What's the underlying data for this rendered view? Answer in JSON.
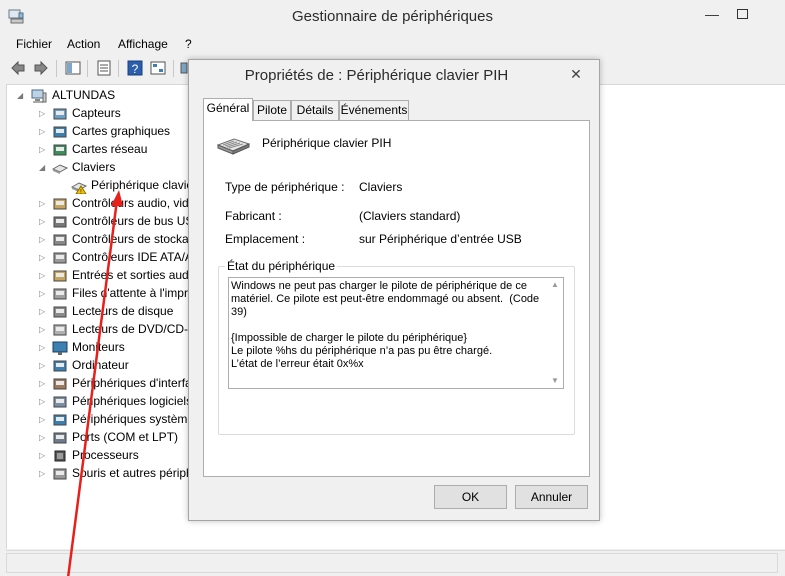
{
  "main_window": {
    "title": "Gestionnaire de périphériques",
    "minimize_glyph": "—"
  },
  "menu": {
    "items": [
      "Fichier",
      "Action",
      "Affichage",
      "?"
    ]
  },
  "tree": {
    "root": "ALTUNDAS",
    "items": [
      {
        "label": "Capteurs",
        "icon": "sensor-icon"
      },
      {
        "label": "Cartes graphiques",
        "icon": "display-adapter-icon"
      },
      {
        "label": "Cartes réseau",
        "icon": "network-adapter-icon"
      },
      {
        "label": "Claviers",
        "icon": "keyboard-icon"
      },
      {
        "label": "Périphérique clavie",
        "icon": "keyboard-warning-icon"
      },
      {
        "label": "Contrôleurs audio, vid",
        "icon": "audio-icon"
      },
      {
        "label": "Contrôleurs de bus US",
        "icon": "usb-icon"
      },
      {
        "label": "Contrôleurs de stockag",
        "icon": "storage-icon"
      },
      {
        "label": "Contrôleurs IDE ATA/A",
        "icon": "ide-icon"
      },
      {
        "label": "Entrées et sorties audic",
        "icon": "audio-io-icon"
      },
      {
        "label": "Files d'attente à l'impre",
        "icon": "printer-icon"
      },
      {
        "label": "Lecteurs de disque",
        "icon": "disk-icon"
      },
      {
        "label": "Lecteurs de DVD/CD-R",
        "icon": "dvd-icon"
      },
      {
        "label": "Moniteurs",
        "icon": "monitor-icon"
      },
      {
        "label": "Ordinateur",
        "icon": "computer-icon"
      },
      {
        "label": "Périphériques d'interfa",
        "icon": "hid-icon"
      },
      {
        "label": "Périphériques logiciels",
        "icon": "software-device-icon"
      },
      {
        "label": "Périphériques système",
        "icon": "system-device-icon"
      },
      {
        "label": "Ports (COM et LPT)",
        "icon": "port-icon"
      },
      {
        "label": "Processeurs",
        "icon": "processor-icon"
      },
      {
        "label": "Souris et autres périph",
        "icon": "mouse-icon"
      }
    ]
  },
  "dialog": {
    "title": "Propriétés de : Périphérique clavier PIH",
    "close_glyph": "✕",
    "tabs": [
      "Général",
      "Pilote",
      "Détails",
      "Événements"
    ],
    "device_name": "Périphérique clavier PIH",
    "properties": {
      "type_label": "Type de périphérique :",
      "type_value": "Claviers",
      "manufacturer_label": "Fabricant :",
      "manufacturer_value": "(Claviers standard)",
      "location_label": "Emplacement :",
      "location_value": "sur Périphérique d’entrée USB"
    },
    "status_group_title": "État du périphérique",
    "status_text": "Windows ne peut pas charger le pilote de périphérique de ce\nmatériel. Ce pilote est peut-être endommagé ou absent.  (Code 39)\n\n{Impossible de charger le pilote du périphérique}\nLe pilote %hs du périphérique n’a pas pu être chargé.\nL’état de l’erreur était 0x%x",
    "ok_label": "OK",
    "cancel_label": "Annuler"
  },
  "colors": {
    "window_bg": "#f0f0f0",
    "selection_blue": "#3c7fb1",
    "annotation_red": "#e8201c",
    "warning_yellow": "#f5c400"
  }
}
